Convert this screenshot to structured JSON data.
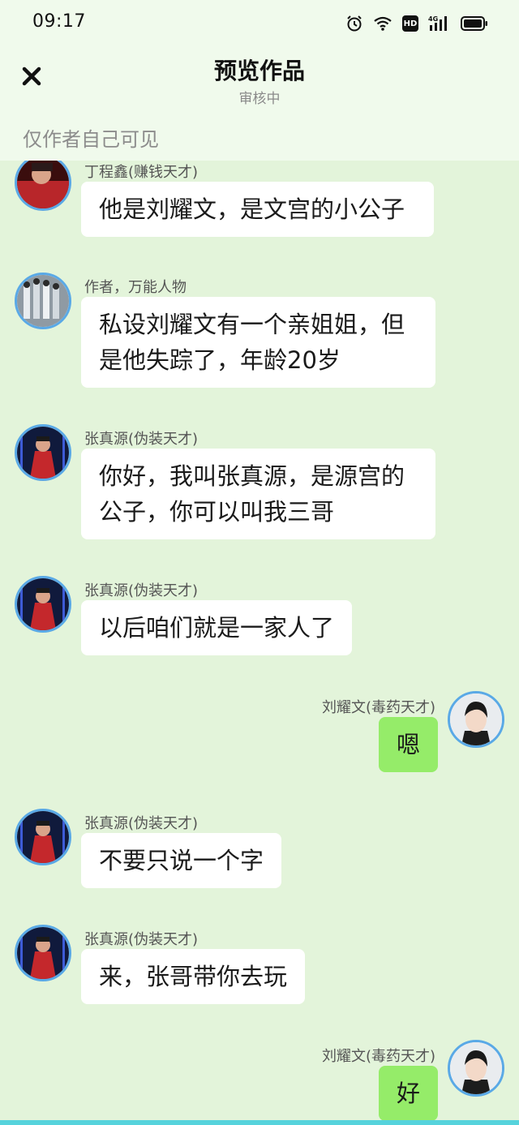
{
  "status_bar": {
    "time": "09:17"
  },
  "header": {
    "close_icon": "close-icon",
    "title": "预览作品",
    "subtitle": "审核中",
    "notice": "仅作者自己可见"
  },
  "messages": [
    {
      "side": "left",
      "sender": "丁程鑫(赚钱天才)",
      "text": "他是刘耀文，是文宫的小公子",
      "avatar": "avatar-dingchengxin"
    },
    {
      "side": "left",
      "sender": "作者，万能人物",
      "text": "私设刘耀文有一个亲姐姐，但是他失踪了，年龄20岁",
      "avatar": "avatar-group"
    },
    {
      "side": "left",
      "sender": "张真源(伪装天才)",
      "text": "你好，我叫张真源，是源宫的公子，你可以叫我三哥",
      "avatar": "avatar-zhangzhenyuan"
    },
    {
      "side": "left",
      "sender": "张真源(伪装天才)",
      "text": "以后咱们就是一家人了",
      "avatar": "avatar-zhangzhenyuan"
    },
    {
      "side": "right",
      "sender": "刘耀文(毒药天才)",
      "text": "嗯",
      "avatar": "avatar-liuyaowen"
    },
    {
      "side": "left",
      "sender": "张真源(伪装天才)",
      "text": "不要只说一个字",
      "avatar": "avatar-zhangzhenyuan"
    },
    {
      "side": "left",
      "sender": "张真源(伪装天才)",
      "text": "来，张哥带你去玩",
      "avatar": "avatar-zhangzhenyuan"
    },
    {
      "side": "right",
      "sender": "刘耀文(毒药天才)",
      "text": "好",
      "avatar": "avatar-liuyaowen"
    }
  ]
}
